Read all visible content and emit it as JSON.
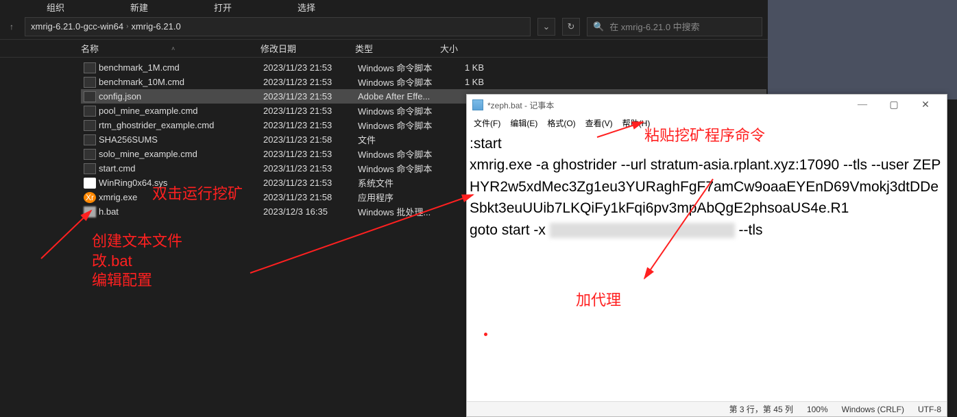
{
  "toolbar": {
    "org": "组织",
    "new": "新建",
    "open": "打开",
    "select": "选择"
  },
  "breadcrumb": {
    "p1": "xmrig-6.21.0-gcc-win64",
    "p2": "xmrig-6.21.0"
  },
  "search": {
    "placeholder": "在 xmrig-6.21.0 中搜索"
  },
  "columns": {
    "name": "名称",
    "date": "修改日期",
    "type": "类型",
    "size": "大小"
  },
  "files": [
    {
      "icon": "cmd",
      "name": "benchmark_1M.cmd",
      "date": "2023/11/23 21:53",
      "type": "Windows 命令脚本",
      "size": "1 KB"
    },
    {
      "icon": "cmd",
      "name": "benchmark_10M.cmd",
      "date": "2023/11/23 21:53",
      "type": "Windows 命令脚本",
      "size": "1 KB"
    },
    {
      "icon": "json",
      "name": "config.json",
      "date": "2023/11/23 21:53",
      "type": "Adobe After Effe...",
      "size": "",
      "selected": true
    },
    {
      "icon": "cmd",
      "name": "pool_mine_example.cmd",
      "date": "2023/11/23 21:53",
      "type": "Windows 命令脚本",
      "size": ""
    },
    {
      "icon": "cmd",
      "name": "rtm_ghostrider_example.cmd",
      "date": "2023/11/23 21:53",
      "type": "Windows 命令脚本",
      "size": ""
    },
    {
      "icon": "file",
      "name": "SHA256SUMS",
      "date": "2023/11/23 21:58",
      "type": "文件",
      "size": ""
    },
    {
      "icon": "cmd",
      "name": "solo_mine_example.cmd",
      "date": "2023/11/23 21:53",
      "type": "Windows 命令脚本",
      "size": ""
    },
    {
      "icon": "cmd",
      "name": "start.cmd",
      "date": "2023/11/23 21:53",
      "type": "Windows 命令脚本",
      "size": ""
    },
    {
      "icon": "sys",
      "name": "WinRing0x64.sys",
      "date": "2023/11/23 21:53",
      "type": "系统文件",
      "size": ""
    },
    {
      "icon": "exe",
      "name": "xmrig.exe",
      "date": "2023/11/23 21:58",
      "type": "应用程序",
      "size": ""
    },
    {
      "icon": "blur",
      "name": "     h.bat",
      "date": "2023/12/3 16:35",
      "type": "Windows 批处理...",
      "size": ""
    }
  ],
  "notepad": {
    "title": "*zeph.bat - 记事本",
    "menu": {
      "file": "文件(F)",
      "edit": "编辑(E)",
      "format": "格式(O)",
      "view": "查看(V)",
      "help": "帮助(H)"
    },
    "lines": {
      "l1": ":start",
      "l2": "xmrig.exe -a ghostrider --url stratum-asia.rplant.xyz:17090 --tls --user ZEPHYR2w5xdMec3Zg1eu3YURaghFgF7amCw9oaaEYEnD69Vmokj3dtDDeSbkt3euUUib7LKQiFy1kFqi6pv3mpAbQgE2phsoaUS4e.R1",
      "l3a": "goto start -x ",
      "l3b": " --tls"
    },
    "status": {
      "pos": "第 3 行，第 45 列",
      "zoom": "100%",
      "eol": "Windows (CRLF)",
      "enc": "UTF-8"
    }
  },
  "annotations": {
    "dblclick": "双击运行挖矿",
    "create": "创建文本文件\n改.bat\n编辑配置",
    "paste": "粘贴挖矿程序命令",
    "proxy": "加代理"
  }
}
